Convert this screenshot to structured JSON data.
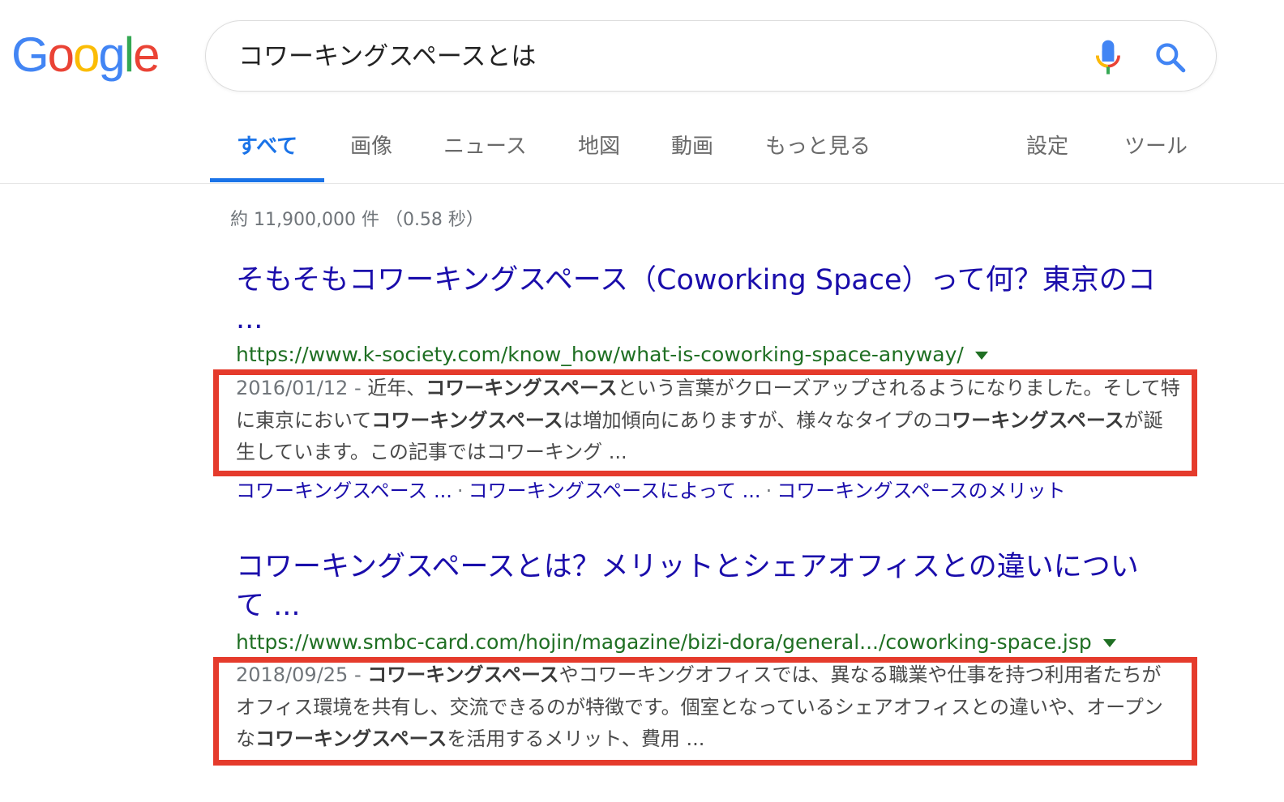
{
  "logo": {
    "letters": [
      "G",
      "o",
      "o",
      "g",
      "l",
      "e"
    ],
    "colors": [
      "#4285F4",
      "#EA4335",
      "#FBBC05",
      "#4285F4",
      "#34A853",
      "#EA4335"
    ]
  },
  "search": {
    "query": "コワーキングスペースとは"
  },
  "icons": {
    "mic": "microphone-icon",
    "search": "search-icon"
  },
  "tabs": {
    "all": "すべて",
    "images": "画像",
    "news": "ニュース",
    "maps": "地図",
    "videos": "動画",
    "more": "もっと見る",
    "settings": "設定",
    "tools": "ツール"
  },
  "stats": "約 11,900,000 件 （0.58 秒）",
  "results": [
    {
      "title_line1": "そもそもコワーキングスペース（Coworking Space）って何？東京のコ",
      "title_line2": "...",
      "url": "https://www.k-society.com/know_how/what-is-coworking-space-anyway/",
      "snippet": {
        "date": "2016/01/12 - ",
        "s1": "近年、",
        "b1": "コワーキングスペース",
        "s2": "という言葉がクローズアップされるようになりました。そして特に東京において",
        "b2": "コワーキングスペース",
        "s3": "は増加傾向にありますが、様々なタイプのコ",
        "b3": "ワーキングスペース",
        "s4": "が誕生しています。この記事ではコワーキング ..."
      },
      "sitelinks": [
        "コワーキングスペース ...",
        "コワーキングスペースによって ...",
        "コワーキングスペースのメリット"
      ]
    },
    {
      "title_line1": "コワーキングスペースとは？メリットとシェアオフィスとの違いについ",
      "title_line2": "て ...",
      "url": "https://www.smbc-card.com/hojin/magazine/bizi-dora/general.../coworking-space.jsp",
      "snippet": {
        "date": "2018/09/25 - ",
        "b1": "コワーキングスペース",
        "s1": "やコワーキングオフィスでは、異なる職業や仕事を持つ利用者たちがオフィス環境を共有し、交流できるのが特徴です。個室となっているシェアオフィスとの違いや、オープンな",
        "b2": "コワーキングスペース",
        "s2": "を活用するメリット、費用 ..."
      }
    }
  ],
  "highlight_color": "#E53B2C",
  "sitelink_separator": "·"
}
